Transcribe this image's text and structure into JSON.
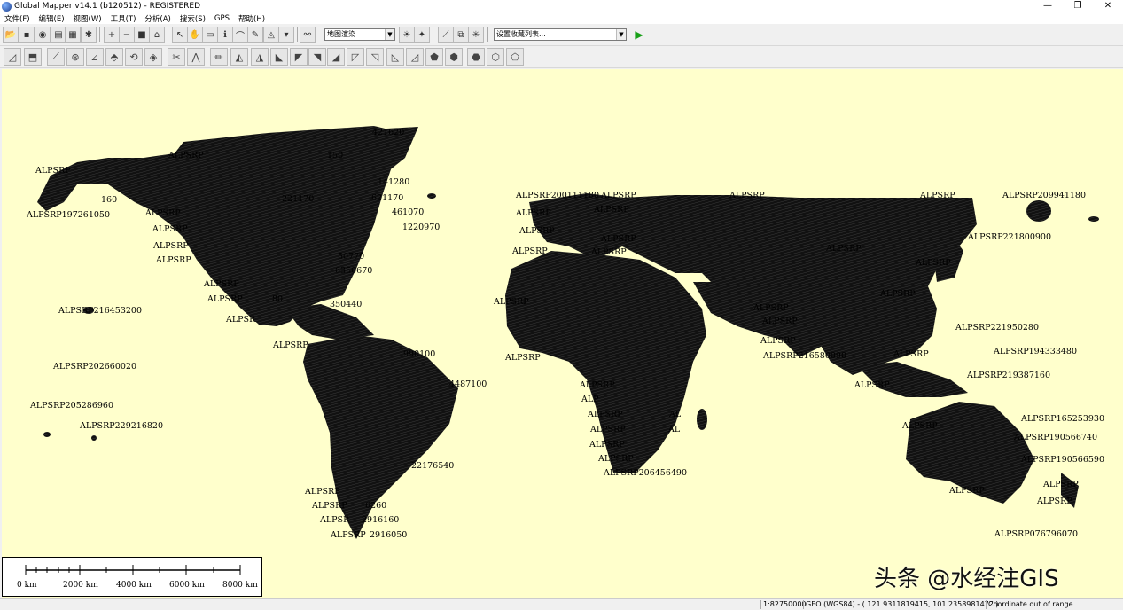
{
  "window": {
    "title": "Global Mapper v14.1 (b120512) - REGISTERED",
    "controls": [
      "—",
      "❐",
      "✕"
    ]
  },
  "menu": [
    "文件(F)",
    "编辑(E)",
    "视图(W)",
    "工具(T)",
    "分析(A)",
    "搜索(S)",
    "GPS",
    "帮助(H)"
  ],
  "toolbar": {
    "layer_combo": "地图渲染",
    "favorites_combo": "设置收藏列表..."
  },
  "map": {
    "background": "#ffffcc",
    "labels": [
      {
        "id": "l1",
        "text": "421620"
      },
      {
        "id": "l2",
        "text": "ALPSRP"
      },
      {
        "id": "l3",
        "text": "ALPSRP"
      },
      {
        "id": "l4",
        "text": "160"
      },
      {
        "id": "l5",
        "text": "ALPSRP197261050"
      },
      {
        "id": "l6",
        "text": "ALPSRP"
      },
      {
        "id": "l7",
        "text": "ALPSRP"
      },
      {
        "id": "l8",
        "text": "ALPSRP"
      },
      {
        "id": "l9",
        "text": "ALPSRP"
      },
      {
        "id": "l10",
        "text": "ALPSRP"
      },
      {
        "id": "l11",
        "text": "ALPSRP"
      },
      {
        "id": "l12",
        "text": "ALPSR"
      },
      {
        "id": "l13",
        "text": "ALP"
      },
      {
        "id": "l14",
        "text": "ALPSRP"
      },
      {
        "id": "l15",
        "text": "ALPSR"
      },
      {
        "id": "l16",
        "text": "ALPSRP"
      },
      {
        "id": "l17",
        "text": "ALPSRP"
      },
      {
        "id": "l18",
        "text": "AL"
      },
      {
        "id": "l19",
        "text": "ALPSR"
      },
      {
        "id": "l20",
        "text": "141280"
      },
      {
        "id": "l21",
        "text": "621170"
      },
      {
        "id": "l22",
        "text": "461070"
      },
      {
        "id": "l23",
        "text": "1220970"
      },
      {
        "id": "l24",
        "text": "221170"
      },
      {
        "id": "l25",
        "text": "150"
      },
      {
        "id": "l26",
        "text": "50770"
      },
      {
        "id": "l27",
        "text": "6350670"
      },
      {
        "id": "l28",
        "text": "80"
      },
      {
        "id": "l29",
        "text": "350440"
      },
      {
        "id": "l30",
        "text": "990100"
      },
      {
        "id": "l31",
        "text": "4487100"
      },
      {
        "id": "l32",
        "text": "22176540"
      },
      {
        "id": "l33",
        "text": "00"
      },
      {
        "id": "l34",
        "text": "ALPSRP"
      },
      {
        "id": "l35",
        "text": "ALPSRP"
      },
      {
        "id": "l36",
        "text": "6260"
      },
      {
        "id": "l37",
        "text": "ALPSR"
      },
      {
        "id": "l38",
        "text": "2916160"
      },
      {
        "id": "l39",
        "text": "ALPSRP"
      },
      {
        "id": "l40",
        "text": "2916050"
      },
      {
        "id": "l41",
        "text": "ALPSRP216453200"
      },
      {
        "id": "l42",
        "text": "ALPSRP202660020"
      },
      {
        "id": "l43",
        "text": "ALPSRP205286960"
      },
      {
        "id": "l44",
        "text": "ALPSRP229216820"
      },
      {
        "id": "l45",
        "text": "ALPSRP200111180"
      },
      {
        "id": "l46",
        "text": "ALPSRP"
      },
      {
        "id": "l47",
        "text": "ALPSRP"
      },
      {
        "id": "l48",
        "text": "ALPSRP"
      },
      {
        "id": "l49",
        "text": "ALPSRP"
      },
      {
        "id": "l50",
        "text": "ALPSRP"
      },
      {
        "id": "l51",
        "text": "ALPSRP"
      },
      {
        "id": "l52",
        "text": "ALPSRP"
      },
      {
        "id": "l53",
        "text": "ALPSRP"
      },
      {
        "id": "l54",
        "text": "ALPSRP"
      },
      {
        "id": "l55",
        "text": "ALPSRP"
      },
      {
        "id": "l56",
        "text": "ALP"
      },
      {
        "id": "l57",
        "text": "ALPSRP"
      },
      {
        "id": "l58",
        "text": "ALPSRP"
      },
      {
        "id": "l59",
        "text": "AL"
      },
      {
        "id": "l60",
        "text": "AL"
      },
      {
        "id": "l61",
        "text": "ALPSRP"
      },
      {
        "id": "l62",
        "text": "ALPSRP"
      },
      {
        "id": "l63",
        "text": "ALPSRP"
      },
      {
        "id": "l64",
        "text": "ALPSRP"
      },
      {
        "id": "l65",
        "text": "ALPSRP206456490"
      },
      {
        "id": "l66",
        "text": "ALPSRP"
      },
      {
        "id": "l67",
        "text": "ALPSRP"
      },
      {
        "id": "l68",
        "text": "ALPSRP"
      },
      {
        "id": "l69",
        "text": "ALPSRP"
      },
      {
        "id": "l70",
        "text": "ALPSRP"
      },
      {
        "id": "l71",
        "text": "ALPSRP216580090"
      },
      {
        "id": "l72",
        "text": "ALPSRP"
      },
      {
        "id": "l73",
        "text": "ALPSRP"
      },
      {
        "id": "l74",
        "text": "ALPSRP"
      },
      {
        "id": "l75",
        "text": "ALPSRP"
      },
      {
        "id": "l76",
        "text": "ALPSRP"
      },
      {
        "id": "l77",
        "text": "ALPSRP"
      },
      {
        "id": "l78",
        "text": "ALPSRP"
      },
      {
        "id": "l79",
        "text": "ALPSRP"
      },
      {
        "id": "l80",
        "text": "ALPSRP"
      },
      {
        "id": "l81",
        "text": "ALPSRP209941180"
      },
      {
        "id": "l82",
        "text": "ALPSRP221800900"
      },
      {
        "id": "l83",
        "text": "ALPSRP221950280"
      },
      {
        "id": "l84",
        "text": "ALPSRP194333480"
      },
      {
        "id": "l85",
        "text": "ALPSRP219387160"
      },
      {
        "id": "l86",
        "text": "ALPSRP165253930"
      },
      {
        "id": "l87",
        "text": "ALPSRP190566740"
      },
      {
        "id": "l88",
        "text": "ALPSRP190566590"
      },
      {
        "id": "l89",
        "text": "ALPSRP"
      },
      {
        "id": "l90",
        "text": "ALPSRP"
      },
      {
        "id": "l91",
        "text": "ALPSRP"
      },
      {
        "id": "l92",
        "text": "ALPSRP076796070"
      }
    ]
  },
  "scalebar": {
    "ticks": [
      "0 km",
      "2000 km",
      "4000 km",
      "6000 km",
      "8000 km"
    ]
  },
  "watermark": "头条 @水经注GIS",
  "status": {
    "scale": "1:82750000",
    "coords": "GEO (WGS84) - ( 121.9311819415, 101.2358981472 )",
    "message": "Coordinate out of range"
  }
}
